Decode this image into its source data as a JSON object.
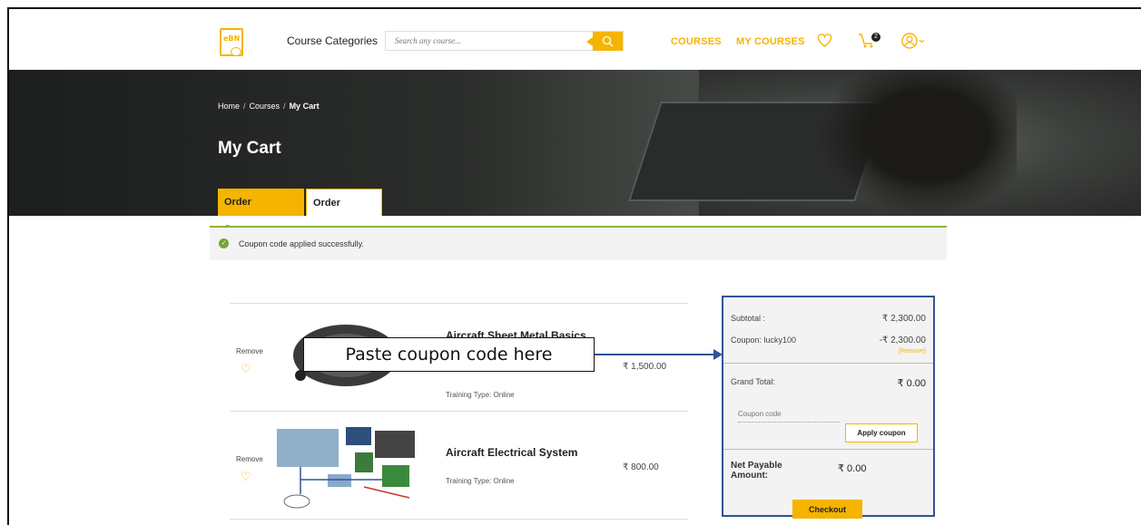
{
  "header": {
    "logo_text": "eBN",
    "categories_label": "Course Categories",
    "search_placeholder": "Search any course...",
    "nav": [
      "COURSES",
      "MY COURSES"
    ],
    "cart_count": "2",
    "search_icon": "search-icon",
    "wishlist_icon": "heart-icon",
    "cart_icon": "cart-icon",
    "user_icon": "user-icon"
  },
  "hero": {
    "breadcrumbs": [
      "Home",
      "Courses",
      "My Cart"
    ],
    "breadcrumb_sep": "/",
    "title": "My Cart",
    "tabs": [
      "Order Summary",
      "Order History"
    ]
  },
  "alert": {
    "message": "Coupon code applied successfully."
  },
  "cart": {
    "items": [
      {
        "name": "Aircraft Sheet Metal Basics",
        "training_type": "Training Type: Online",
        "price": "₹ 1,500.00",
        "remove_label": "Remove"
      },
      {
        "name": "Aircraft Electrical System",
        "training_type": "Training Type: Online",
        "price": "₹ 800.00",
        "remove_label": "Remove"
      }
    ]
  },
  "summary": {
    "subtotal_label": "Subtotal :",
    "subtotal_value": "₹ 2,300.00",
    "coupon_label": "Coupon: lucky100",
    "coupon_value": "-₹ 2,300.00",
    "coupon_remove": "[Remove]",
    "grand_total_label": "Grand Total:",
    "grand_total_value": "₹ 0.00",
    "coupon_placeholder": "Coupon code",
    "apply_label": "Apply coupon",
    "net_label": "Net Payable Amount:",
    "net_value": "₹ 0.00",
    "checkout_label": "Checkout"
  },
  "annotation": {
    "callout_text": "Paste coupon code here",
    "arrow_color": "#2f5597"
  },
  "colors": {
    "accent": "#f5b400",
    "success": "#79a33a",
    "highlight_border": "#2f5597"
  }
}
